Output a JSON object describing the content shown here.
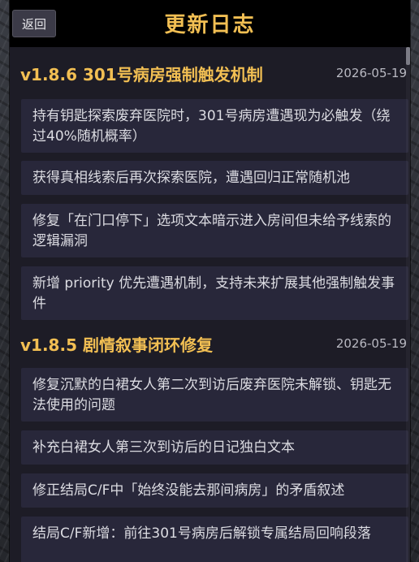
{
  "header": {
    "back_label": "返回",
    "title": "更新日志"
  },
  "versions": [
    {
      "title": "v1.8.6  301号病房强制触发机制",
      "date": "2026-05-19",
      "entries": [
        "持有钥匙探索废弃医院时，301号病房遭遇现为必触发（绕过40%随机概率）",
        "获得真相线索后再次探索医院，遭遇回归正常随机池",
        "修复「在门口停下」选项文本暗示进入房间但未给予线索的逻辑漏洞",
        "新增 priority 优先遭遇机制，支持未来扩展其他强制触发事件"
      ]
    },
    {
      "title": "v1.8.5  剧情叙事闭环修复",
      "date": "2026-05-19",
      "entries": [
        "修复沉默的白裙女人第二次到访后废弃医院未解锁、钥匙无法使用的问题",
        "补充白裙女人第三次到访后的日记独白文本",
        "修正结局C/F中「始终没能去那间病房」的矛盾叙述",
        "结局C/F新增：前往301号病房后解锁专属结局回响段落"
      ]
    }
  ]
}
